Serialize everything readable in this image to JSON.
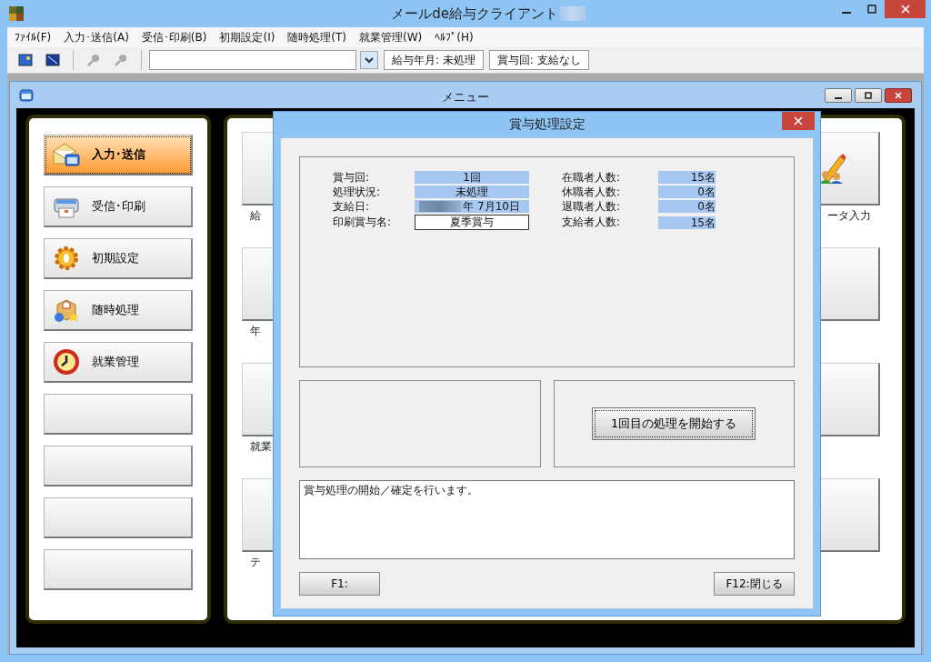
{
  "window": {
    "title": "メールde給与クライアント",
    "title_redacted": true
  },
  "menu": [
    "ﾌｧｲﾙ(F)",
    "入力･送信(A)",
    "受信･印刷(B)",
    "初期設定(I)",
    "随時処理(T)",
    "就業管理(W)",
    "ﾍﾙﾌﾟ(H)"
  ],
  "toolbar": {
    "fields": [
      "給与年月: 未処理",
      "賞与回: 支給なし"
    ]
  },
  "child_window": {
    "title": "メニュー"
  },
  "nav": [
    {
      "kind": "icon",
      "label": "入力･送信",
      "selected": true
    },
    {
      "kind": "icon",
      "label": "受信･印刷",
      "selected": false
    },
    {
      "kind": "icon",
      "label": "初期設定",
      "selected": false
    },
    {
      "kind": "icon",
      "label": "随時処理",
      "selected": false
    },
    {
      "kind": "icon",
      "label": "就業管理",
      "selected": false
    },
    {
      "kind": "blank",
      "selected": false
    },
    {
      "kind": "blank",
      "selected": false
    },
    {
      "kind": "blank",
      "selected": false
    },
    {
      "kind": "blank",
      "selected": false
    }
  ],
  "tiles_left": [
    {
      "label": "給"
    },
    {
      "label": "年"
    },
    {
      "label": "就業"
    },
    {
      "label": "テ"
    }
  ],
  "tiles_right": [
    {
      "kind": "icon",
      "label": "ータ入力"
    },
    {
      "kind": "blank"
    },
    {
      "kind": "blank"
    },
    {
      "kind": "blank"
    }
  ],
  "dialog": {
    "title": "賞与処理設定",
    "left_fields": [
      {
        "label": "賞与回:",
        "value": "1回",
        "kind": "display"
      },
      {
        "label": "処理状況:",
        "value": "未処理",
        "kind": "display"
      },
      {
        "label": "支給日:",
        "value": "年 7月10日",
        "kind": "display",
        "redacted_prefix": true
      },
      {
        "label": "印刷賞与名:",
        "value": "夏季賞与",
        "kind": "input"
      }
    ],
    "right_fields": [
      {
        "label": "在職者人数:",
        "value": "15名"
      },
      {
        "label": "休職者人数:",
        "value": "0名"
      },
      {
        "label": "退職者人数:",
        "value": "0名"
      },
      {
        "label": "支給者人数:",
        "value": "15名"
      }
    ],
    "start_button": {
      "label": "1回目の処理を開始する",
      "focused": true
    },
    "message": "賞与処理の開始／確定を行います。",
    "buttons": [
      "F1:",
      "F12:閉じる"
    ]
  }
}
